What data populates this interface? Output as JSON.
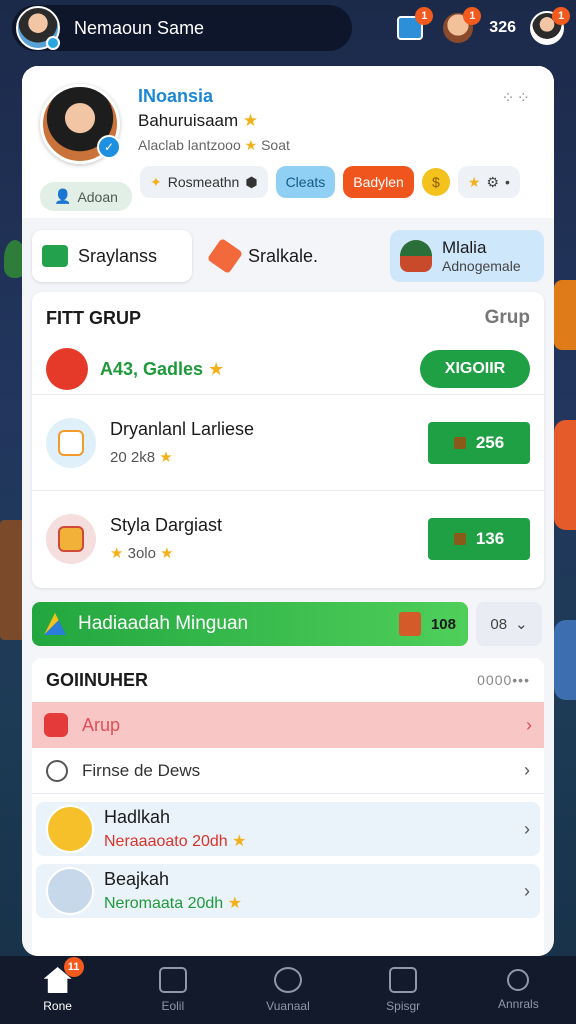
{
  "topbar": {
    "username": "Nemaoun Same",
    "calendar_badge": "1",
    "face_badge": "1",
    "coin_count": "326",
    "profile_badge": "1"
  },
  "profile": {
    "brand": "INoansia",
    "name": "Bahuruisaam",
    "name_star": "★",
    "subtitle": "Alaclab lantzooo",
    "subtitle_extra": "Soat",
    "adoan_label": "Adoan",
    "chips": {
      "rosm": "Rosmeathn",
      "cleats": "Cleats",
      "badylen": "Badylen"
    }
  },
  "tabs": [
    {
      "label": "Sraylanss"
    },
    {
      "label": "Sralkale."
    },
    {
      "label": "Mlalia",
      "sub": "Adnogemale"
    }
  ],
  "group": {
    "title": "FITT GRUP",
    "right_label": "Grup",
    "first_row_label": "A43, Gadles",
    "first_row_button": "XIGOIIR",
    "items": [
      {
        "name": "Dryanlanl Larliese",
        "sub": "20 2k8",
        "score": "256"
      },
      {
        "name": "Styla Dargiast",
        "sub": "3olo",
        "score": "136"
      }
    ]
  },
  "banner": {
    "label": "Hadiaadah Minguan",
    "value": "108",
    "side_label": "08"
  },
  "section2": {
    "title": "GOIINUHER",
    "dots": "0000•••",
    "alert_label": "Arup",
    "plain_label": "Firnse de Dews",
    "rows": [
      {
        "name": "Hadlkah",
        "sub": "Neraaaoato 20dh",
        "color": "#d8342a"
      },
      {
        "name": "Beajkah",
        "sub": "Neromaata 20dh",
        "color": "#1f9a3b"
      }
    ]
  },
  "nav": [
    {
      "label": "Rone",
      "badge": "11"
    },
    {
      "label": "Eolil"
    },
    {
      "label": "Vuanaal"
    },
    {
      "label": "Spisgr"
    },
    {
      "label": "Annrals"
    }
  ],
  "colors": {
    "accent_green": "#1fa044",
    "accent_blue": "#1b88d6",
    "badge_orange": "#f25a1e"
  }
}
